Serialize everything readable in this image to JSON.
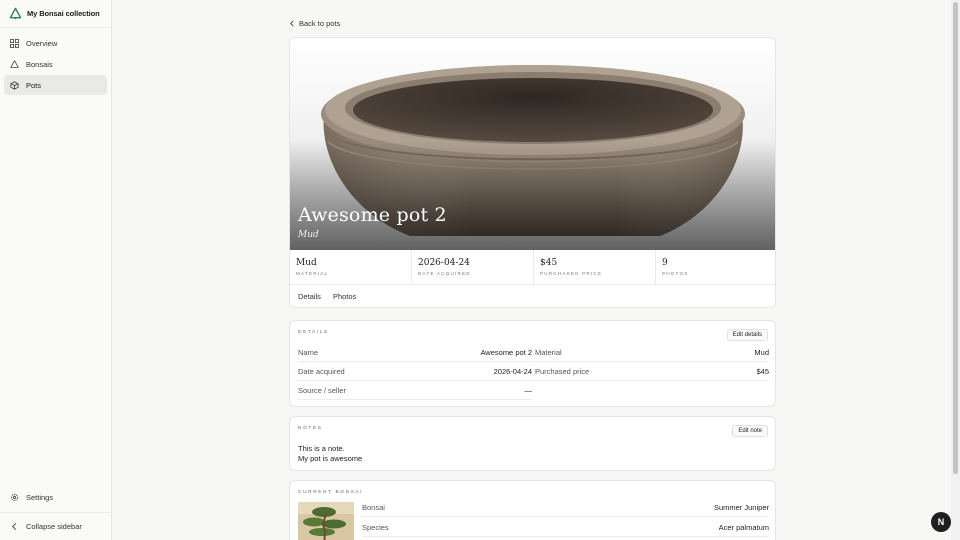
{
  "app": {
    "title": "My Bonsai collection"
  },
  "sidebar": {
    "items": [
      {
        "label": "Overview",
        "icon": "grid-icon"
      },
      {
        "label": "Bonsais",
        "icon": "tree-icon"
      },
      {
        "label": "Pots",
        "icon": "pot-icon",
        "active": true
      }
    ],
    "settings": "Settings",
    "collapse": "Collapse sidebar"
  },
  "nav": {
    "back": "Back to pots"
  },
  "pot": {
    "name": "Awesome pot 2",
    "material": "Mud",
    "stats": [
      {
        "value": "Mud",
        "label": "Material"
      },
      {
        "value": "2026-04-24",
        "label": "Date acquired"
      },
      {
        "value": "$45",
        "label": "Purchased price"
      },
      {
        "value": "9",
        "label": "Photos"
      }
    ],
    "tabs": [
      "Details",
      "Photos"
    ],
    "active_tab": "Details"
  },
  "details": {
    "section_label": "Details",
    "edit_button": "Edit details",
    "rows": [
      {
        "k": "Name",
        "v": "Awesome pot 2"
      },
      {
        "k": "Material",
        "v": "Mud"
      },
      {
        "k": "Date acquired",
        "v": "2026-04-24"
      },
      {
        "k": "Purchased price",
        "v": "$45"
      },
      {
        "k": "Source / seller",
        "v": "—"
      }
    ]
  },
  "notes": {
    "section_label": "Notes",
    "edit_button": "Edit note",
    "line1": "This is a note.",
    "line2": "My pot is awesome"
  },
  "current_bonsai": {
    "section_label": "Current bonsai",
    "rows": [
      {
        "k": "Bonsai",
        "v": "Summer Juniper"
      },
      {
        "k": "Species",
        "v": "Acer palmatum"
      }
    ]
  },
  "fab": {
    "label": "N"
  },
  "colors": {
    "accent": "#2f7d62"
  }
}
